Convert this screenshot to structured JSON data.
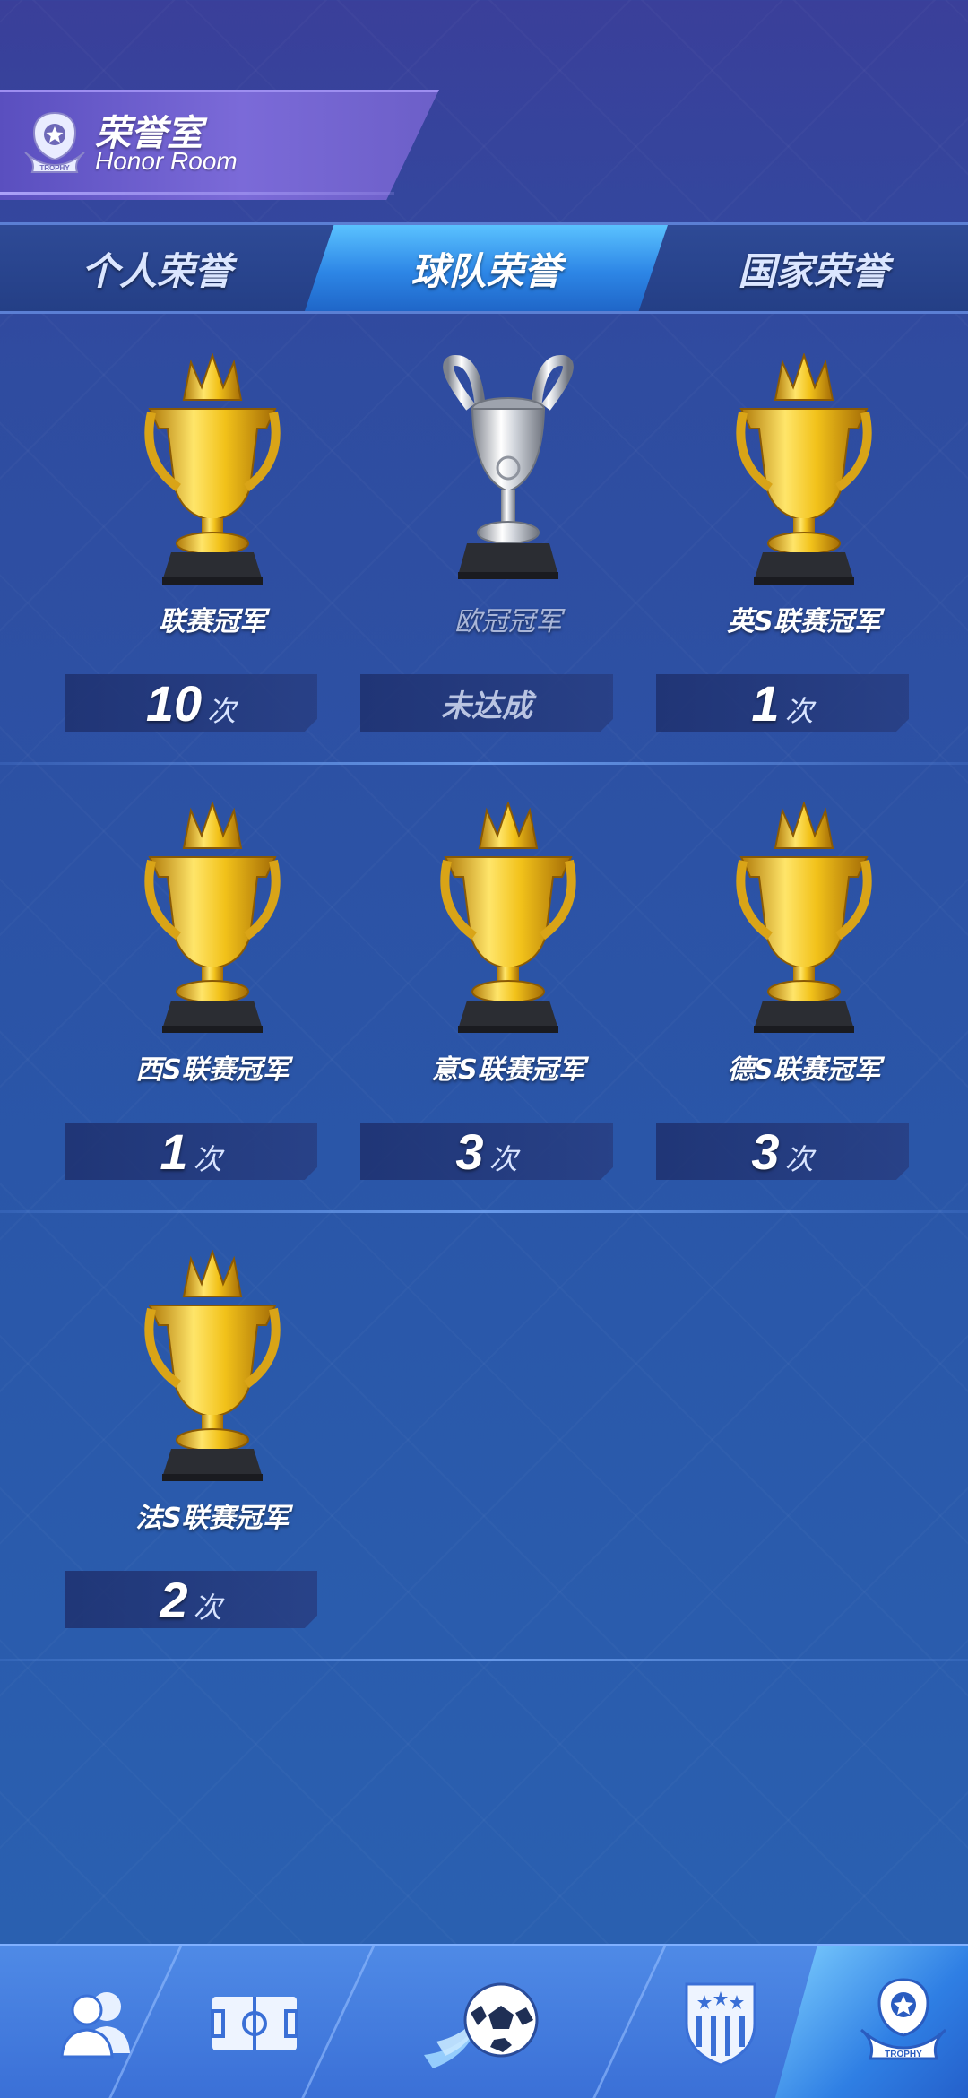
{
  "header": {
    "title": "荣誉室",
    "subtitle": "Honor Room",
    "icon": "trophy-badge-icon",
    "icon_text": "TROPHY"
  },
  "tabs": [
    {
      "label": "个人荣誉",
      "active": false
    },
    {
      "label": "球队荣誉",
      "active": true
    },
    {
      "label": "国家荣誉",
      "active": false
    }
  ],
  "trophies": [
    {
      "name": "联赛冠军",
      "count": "10",
      "unit": "次",
      "achieved": true,
      "kind": "gold"
    },
    {
      "name": "欧冠冠军",
      "status": "未达成",
      "achieved": false,
      "kind": "silver"
    },
    {
      "name": "英S联赛冠军",
      "count": "1",
      "unit": "次",
      "achieved": true,
      "kind": "gold"
    },
    {
      "name": "西S联赛冠军",
      "count": "1",
      "unit": "次",
      "achieved": true,
      "kind": "gold"
    },
    {
      "name": "意S联赛冠军",
      "count": "3",
      "unit": "次",
      "achieved": true,
      "kind": "gold"
    },
    {
      "name": "德S联赛冠军",
      "count": "3",
      "unit": "次",
      "achieved": true,
      "kind": "gold"
    },
    {
      "name": "法S联赛冠军",
      "count": "2",
      "unit": "次",
      "achieved": true,
      "kind": "gold"
    }
  ],
  "bottom_nav": [
    {
      "icon": "players-icon",
      "active": false
    },
    {
      "icon": "pitch-icon",
      "active": false
    },
    {
      "icon": "soccer-ball-icon",
      "active": false
    },
    {
      "icon": "club-crest-icon",
      "active": false
    },
    {
      "icon": "trophy-icon",
      "active": true,
      "icon_text": "TROPHY"
    }
  ],
  "colors": {
    "gold": "#f2c21a",
    "silver": "#cfd3da",
    "active_tab": "#3a9bf0",
    "background": "#2f4ca0"
  }
}
